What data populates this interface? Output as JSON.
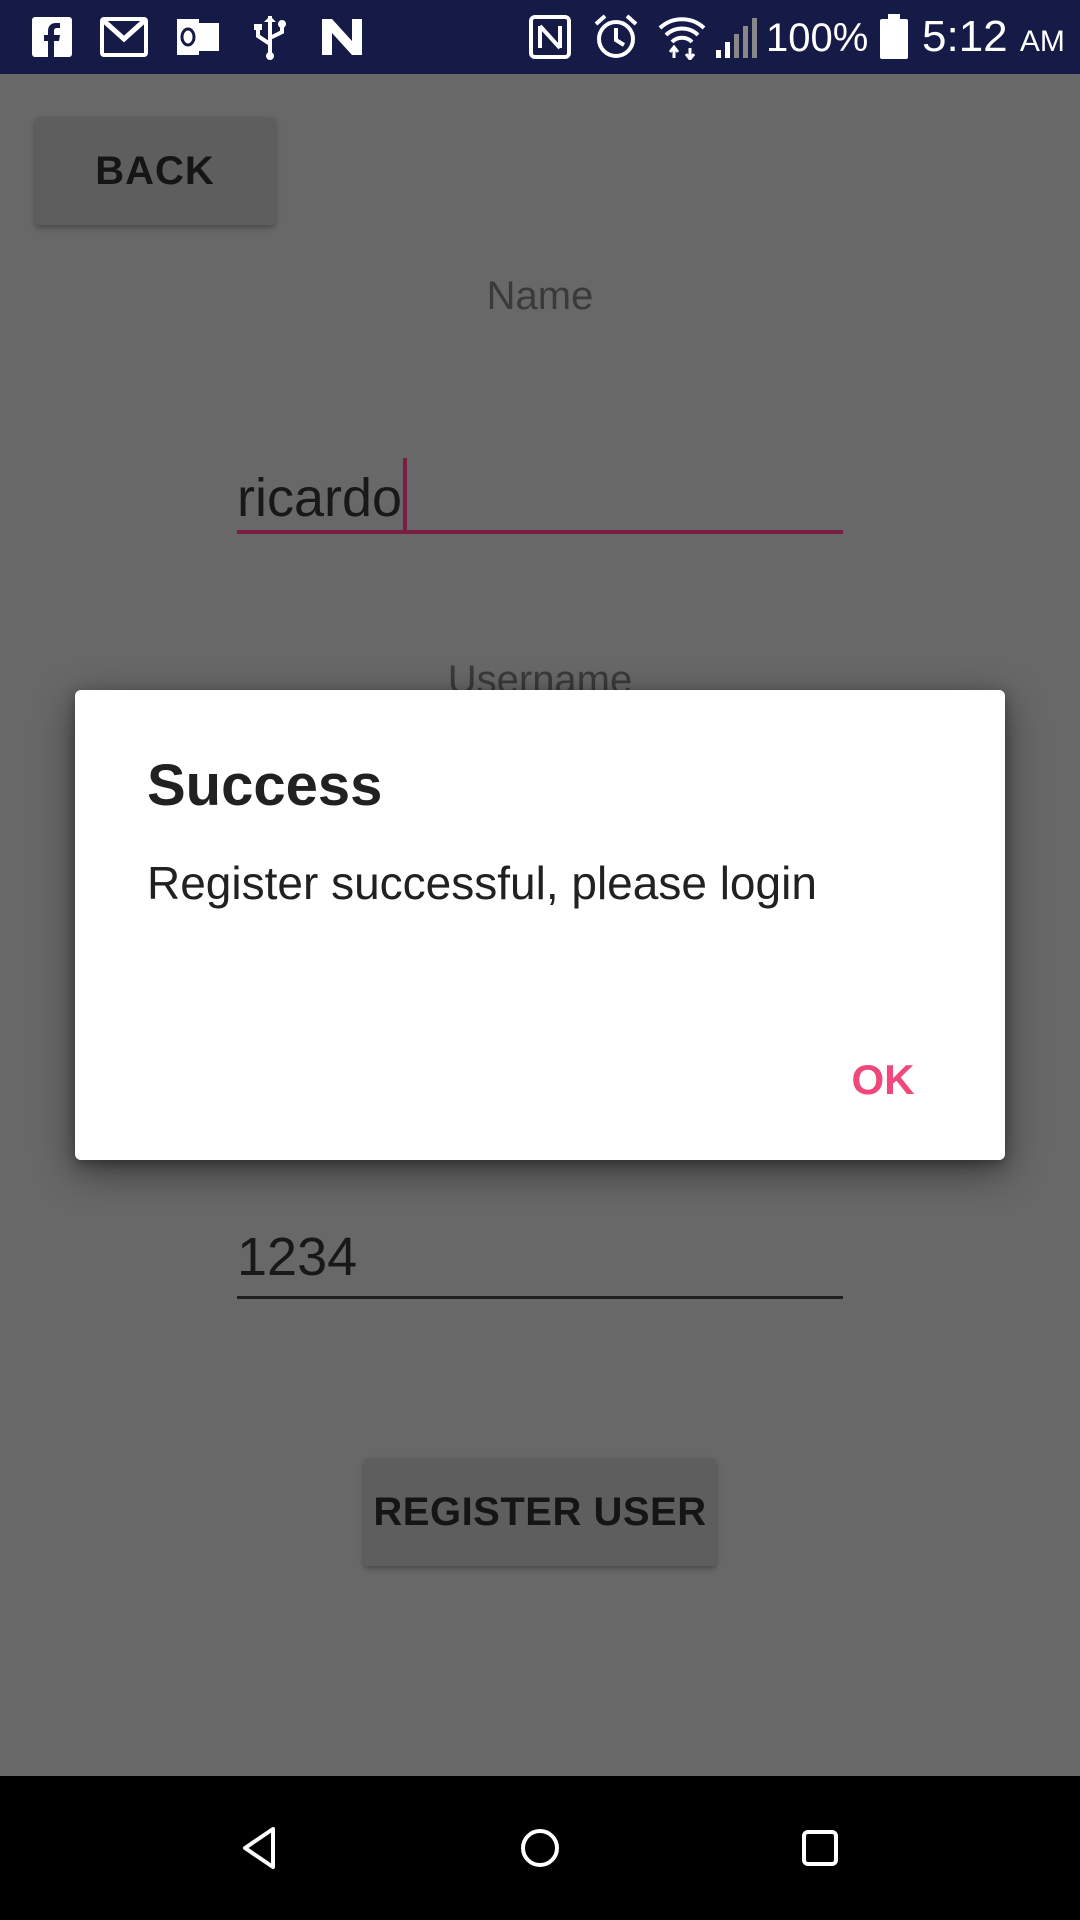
{
  "status_bar": {
    "battery_percent": "100%",
    "time": "5:12",
    "time_suffix": "AM",
    "icons": [
      "facebook-icon",
      "gmail-icon",
      "outlook-icon",
      "usb-icon",
      "n-app-icon",
      "nfc-icon",
      "alarm-icon",
      "wifi-icon",
      "signal-icon",
      "battery-icon"
    ]
  },
  "app": {
    "back_label": "BACK",
    "name_label": "Name",
    "name_value": "ricardo",
    "username_label": "Username",
    "password_value": "1234",
    "register_label": "REGISTER USER"
  },
  "dialog": {
    "title": "Success",
    "message": "Register successful, please login",
    "ok_label": "OK"
  },
  "nav_bar": {
    "icons": [
      "back-nav-icon",
      "home-nav-icon",
      "recents-nav-icon"
    ]
  },
  "colors": {
    "status_bar_bg": "#151a47",
    "accent": "#f0487b",
    "focused_underline": "#7a1f44",
    "scrim_bg": "#686868"
  }
}
